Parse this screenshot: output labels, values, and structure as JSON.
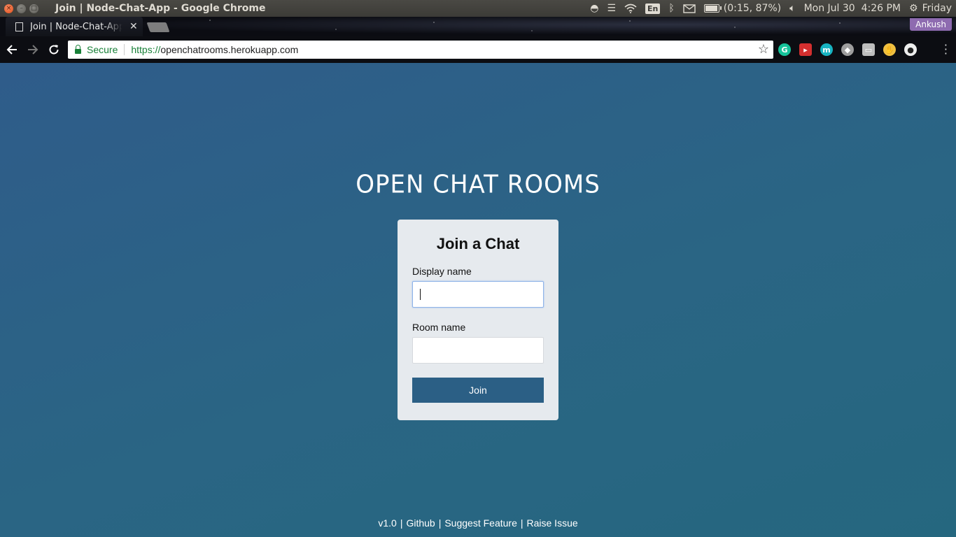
{
  "system_panel": {
    "window_title": "Join | Node-Chat-App - Google Chrome",
    "keyboard_layout": "En",
    "battery_status": "(0:15, 87%)",
    "battery_level": 0.87,
    "clock": "Mon Jul 30  4:26 PM",
    "session_label": "Friday",
    "icons": [
      "dropbox-icon",
      "list-icon",
      "wifi-icon",
      "bluetooth-icon",
      "mail-icon",
      "battery-icon",
      "volume-icon",
      "settings-gear-icon"
    ]
  },
  "browser": {
    "tab": {
      "label": "Join | Node-Chat-App"
    },
    "profile_name": "Ankush",
    "omnibox": {
      "secure_label": "Secure",
      "url_scheme": "https://",
      "url_host": "openchatrooms.herokuapp.com"
    },
    "extensions": [
      {
        "name": "grammarly-icon",
        "color": "#15c39a",
        "glyph": "G"
      },
      {
        "name": "red-extension-icon",
        "color": "#d32f2f",
        "glyph": "▸"
      },
      {
        "name": "m-extension-icon",
        "color": "#17b3c1",
        "glyph": "m"
      },
      {
        "name": "grey-extension-icon",
        "color": "#9e9e9e",
        "glyph": "◆"
      },
      {
        "name": "chat-extension-icon",
        "color": "#bdbdbd",
        "glyph": "▭"
      },
      {
        "name": "hand-extension-icon",
        "color": "#f0c040",
        "glyph": "✋"
      },
      {
        "name": "circle-extension-icon",
        "color": "#eeeeee",
        "glyph": "●"
      }
    ]
  },
  "page": {
    "brand": "OPEN CHAT ROOMS",
    "form": {
      "title": "Join a Chat",
      "display_name_label": "Display name",
      "display_name_value": "",
      "room_name_label": "Room name",
      "room_name_value": "",
      "join_label": "Join"
    },
    "footer": {
      "version": "v1.0",
      "github": "Github",
      "suggest": "Suggest Feature",
      "issue": "Raise Issue",
      "separator": "|"
    },
    "colors": {
      "background_start": "#2f5c8a",
      "background_end": "#25677f",
      "card": "#e6eaee",
      "button": "#2b5f85"
    }
  }
}
